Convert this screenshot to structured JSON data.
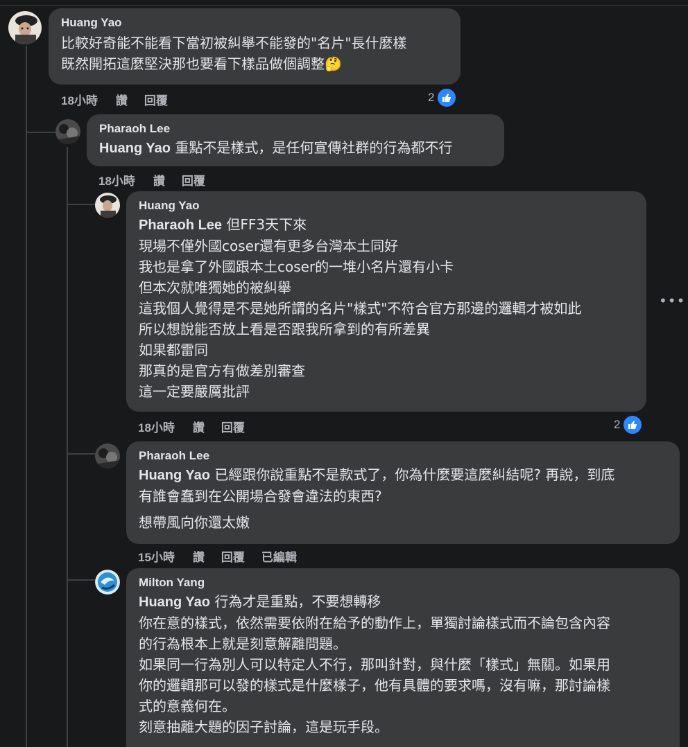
{
  "colors": {
    "background": "#18191a",
    "bubble": "#3a3b3c",
    "like_blue": "#2d88ff"
  },
  "comments": [
    {
      "author": "Huang Yao",
      "mention": "",
      "lines": [
        "比較好奇能不能看下當初被糾舉不能發的\"名片\"長什麼樣",
        "既然開拓這麼堅決那也要看下樣品做個調整🤔"
      ],
      "time": "18小時",
      "like": "讚",
      "reply": "回覆",
      "edited": "",
      "reaction_count": "2"
    },
    {
      "author": "Pharaoh Lee",
      "mention": "Huang Yao",
      "lines": [
        " 重點不是樣式，是任何宣傳社群的行為都不行"
      ],
      "time": "18小時",
      "like": "讚",
      "reply": "回覆",
      "edited": "",
      "reaction_count": ""
    },
    {
      "author": "Huang Yao",
      "mention": "Pharaoh Lee",
      "lines": [
        " 但FF3天下來",
        "現場不僅外國coser還有更多台灣本土同好",
        "我也是拿了外國跟本土coser的一堆小名片還有小卡",
        "但本次就唯獨她的被糾舉",
        "這我個人覺得是不是她所謂的名片\"樣式\"不符合官方那邊的邏輯才被如此",
        "所以想說能否放上看是否跟我所拿到的有所差異",
        "如果都雷同",
        "那真的是官方有做差別審查",
        "這一定要嚴厲批評"
      ],
      "time": "18小時",
      "like": "讚",
      "reply": "回覆",
      "edited": "",
      "reaction_count": "2"
    },
    {
      "author": "Pharaoh Lee",
      "mention": "Huang Yao",
      "lines": [
        " 已經跟你說重點不是款式了，你為什麼要這麼糾結呢? 再說，到底",
        "有誰會蠢到在公開場合發會違法的東西?"
      ],
      "extra": "想帶風向你還太嫩",
      "time": "15小時",
      "like": "讚",
      "reply": "回覆",
      "edited": "已編輯",
      "reaction_count": ""
    },
    {
      "author": "Milton Yang",
      "mention": "Huang Yao",
      "lines": [
        " 行為才是重點，不要想轉移",
        "你在意的樣式，依然需要依附在給予的動作上，單獨討論樣式而不論包含內容",
        "的行為根本上就是刻意解離問題。",
        "如果同一行為別人可以特定人不行，那叫針對，與什麼「樣式」無關。如果用",
        "你的邏輯那可以發的樣式是什麼樣子，他有具體的要求嗎，沒有嘛，那討論樣",
        "式的意義何在。",
        "刻意抽離大題的因子討論，這是玩手段。"
      ]
    }
  ],
  "icons": {
    "more": "more-options-icon",
    "like": "like-thumb-icon"
  }
}
